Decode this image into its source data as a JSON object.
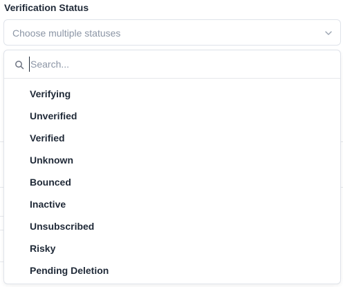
{
  "field": {
    "label": "Verification Status",
    "placeholder": "Choose multiple statuses"
  },
  "icons": {
    "select_chevron": "chevron-down-icon",
    "search": "search-icon"
  },
  "dropdown": {
    "search_placeholder": "Search...",
    "options": [
      "Verifying",
      "Unverified",
      "Verified",
      "Unknown",
      "Bounced",
      "Inactive",
      "Unsubscribed",
      "Risky",
      "Pending Deletion"
    ]
  },
  "colors": {
    "text": "#1f2937",
    "placeholder": "#8b95a5",
    "border": "#dfe3ea"
  }
}
